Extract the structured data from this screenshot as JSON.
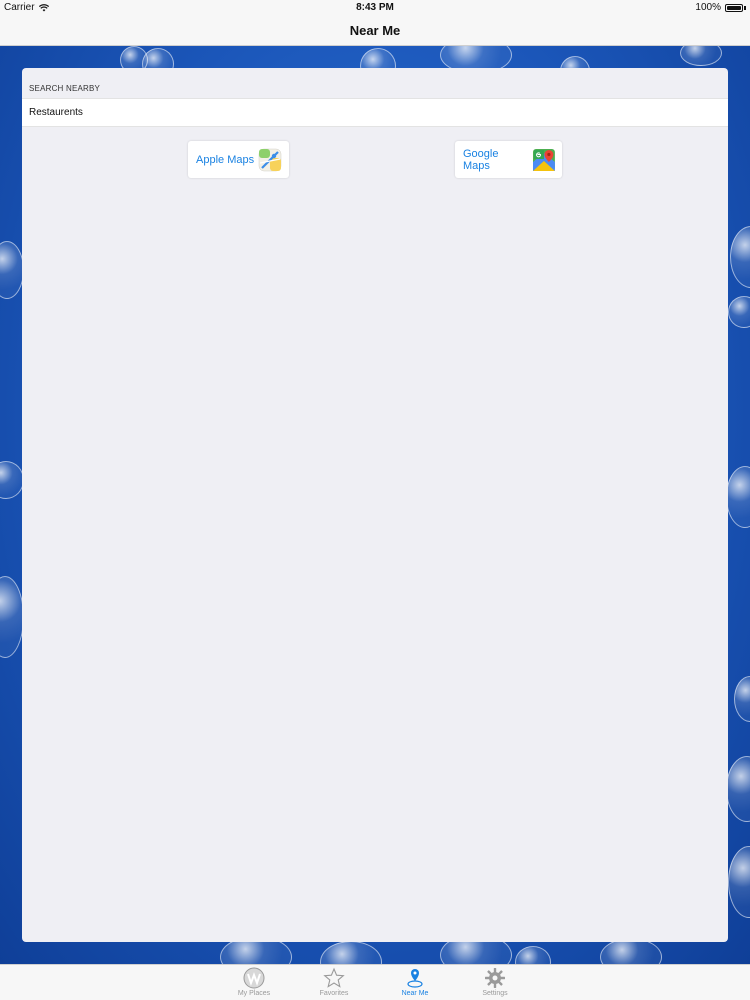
{
  "status_bar": {
    "carrier": "Carrier",
    "time": "8:43 PM",
    "battery": "100%"
  },
  "nav": {
    "title": "Near Me"
  },
  "search": {
    "section_header": "SEARCH NEARBY",
    "value": "Restaurents"
  },
  "buttons": {
    "apple_maps": "Apple Maps",
    "google_maps": "Google Maps"
  },
  "tabs": [
    {
      "label": "My Places",
      "icon": "my-places-icon",
      "active": false
    },
    {
      "label": "Favorites",
      "icon": "star-icon",
      "active": false
    },
    {
      "label": "Near Me",
      "icon": "location-pin-icon",
      "active": true
    },
    {
      "label": "Settings",
      "icon": "gear-icon",
      "active": false
    }
  ],
  "colors": {
    "accent": "#1a82e2",
    "inactive_tab": "#9a9a9a",
    "background_blue": "#1b56b9",
    "panel": "#efeff4"
  }
}
